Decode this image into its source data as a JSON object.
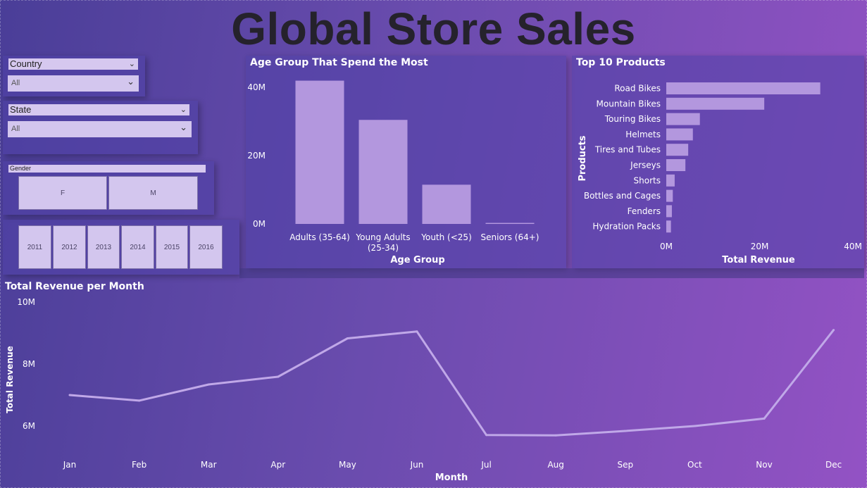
{
  "page": {
    "title": "Global Store Sales"
  },
  "slicers": {
    "country": {
      "label": "Country",
      "value": "All"
    },
    "state": {
      "label": "State",
      "value": "All"
    },
    "gender": {
      "label": "Gender",
      "options": [
        "F",
        "M"
      ]
    },
    "years": [
      "2011",
      "2012",
      "2013",
      "2014",
      "2015",
      "2016"
    ]
  },
  "colors": {
    "bar": "#b397de",
    "line": "#c0a8e8",
    "title": "#25222c"
  },
  "chart_data": [
    {
      "type": "bar",
      "title": "Age Group That Spend the Most",
      "xlabel": "Age Group",
      "ylabel": "",
      "categories": [
        "Adults (35-64)",
        "Young Adults (25-34)",
        "Youth (<25)",
        "Seniors (64+)"
      ],
      "category_lines": [
        [
          "Adults (35-64)"
        ],
        [
          "Young Adults",
          "(25-34)"
        ],
        [
          "Youth (<25)"
        ],
        [
          "Seniors (64+)"
        ]
      ],
      "values": [
        42000000,
        30500000,
        11500000,
        300000
      ],
      "ylim": [
        0,
        45000000
      ],
      "yticks": [
        0,
        20000000,
        40000000
      ],
      "ytick_labels": [
        "0M",
        "20M",
        "40M"
      ],
      "grid": false
    },
    {
      "type": "bar",
      "orientation": "horizontal",
      "title": "Top 10 Products",
      "xlabel": "Total Revenue",
      "ylabel": "Products",
      "categories": [
        "Road Bikes",
        "Mountain Bikes",
        "Touring Bikes",
        "Helmets",
        "Tires and Tubes",
        "Jerseys",
        "Shorts",
        "Bottles and Cages",
        "Fenders",
        "Hydration Packs"
      ],
      "values": [
        33000000,
        21000000,
        7200000,
        5700000,
        4700000,
        4100000,
        1800000,
        1400000,
        1200000,
        1000000
      ],
      "xlim": [
        0,
        40000000
      ],
      "xticks": [
        0,
        20000000,
        40000000
      ],
      "xtick_labels": [
        "0M",
        "20M",
        "40M"
      ],
      "grid": false
    },
    {
      "type": "line",
      "title": "Total Revenue per Month",
      "xlabel": "Month",
      "ylabel": "Total Revenue",
      "x": [
        "Jan",
        "Feb",
        "Mar",
        "Apr",
        "May",
        "Jun",
        "Jul",
        "Aug",
        "Sep",
        "Oct",
        "Nov",
        "Dec"
      ],
      "values": [
        7000000,
        6820000,
        7340000,
        7590000,
        8830000,
        9050000,
        5710000,
        5700000,
        5840000,
        6000000,
        6240000,
        9100000
      ],
      "ylim": [
        5000000,
        10000000
      ],
      "yticks": [
        6000000,
        8000000,
        10000000
      ],
      "ytick_labels": [
        "6M",
        "8M",
        "10M"
      ],
      "grid": false
    }
  ]
}
